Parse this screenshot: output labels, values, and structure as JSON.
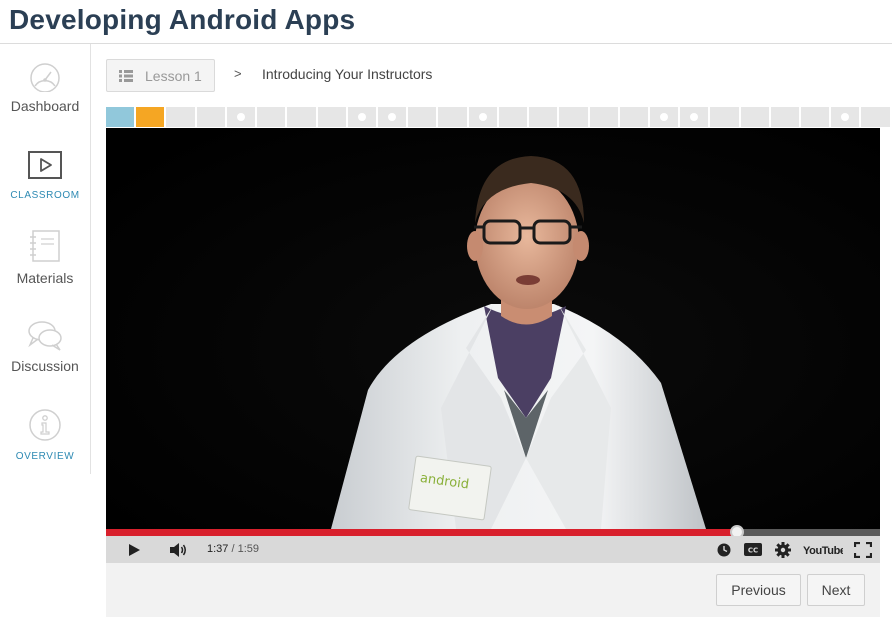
{
  "course": {
    "title": "Developing Android Apps"
  },
  "sidebar": {
    "items": [
      {
        "label": "Dashboard",
        "icon": "speedometer-icon",
        "style": "regular",
        "active": false
      },
      {
        "label": "CLASSROOM",
        "icon": "play-screen-icon",
        "style": "small",
        "active": true
      },
      {
        "label": "Materials",
        "icon": "notebook-icon",
        "style": "regular",
        "active": false
      },
      {
        "label": "Discussion",
        "icon": "chat-bubbles-icon",
        "style": "regular",
        "active": false
      },
      {
        "label": "OVERVIEW",
        "icon": "info-icon",
        "style": "small",
        "active": false
      }
    ]
  },
  "breadcrumb": {
    "lesson_label": "Lesson 1",
    "separator": ">",
    "current": "Introducing Your Instructors"
  },
  "progress_strip": {
    "segments": [
      {
        "state": "viewed"
      },
      {
        "state": "current"
      },
      {
        "state": "unvisited"
      },
      {
        "state": "unvisited"
      },
      {
        "state": "unvisited",
        "quiz": true
      },
      {
        "state": "unvisited"
      },
      {
        "state": "unvisited"
      },
      {
        "state": "unvisited"
      },
      {
        "state": "unvisited",
        "quiz": true
      },
      {
        "state": "unvisited",
        "quiz": true
      },
      {
        "state": "unvisited"
      },
      {
        "state": "unvisited"
      },
      {
        "state": "unvisited",
        "quiz": true
      },
      {
        "state": "unvisited"
      },
      {
        "state": "unvisited"
      },
      {
        "state": "unvisited"
      },
      {
        "state": "unvisited"
      },
      {
        "state": "unvisited"
      },
      {
        "state": "unvisited",
        "quiz": true
      },
      {
        "state": "unvisited",
        "quiz": true
      },
      {
        "state": "unvisited"
      },
      {
        "state": "unvisited"
      },
      {
        "state": "unvisited"
      },
      {
        "state": "unvisited"
      },
      {
        "state": "unvisited",
        "quiz": true
      },
      {
        "state": "unvisited"
      }
    ],
    "colors": {
      "viewed": "#91c8db",
      "current": "#f5a623",
      "unvisited": "#e6e6e6"
    }
  },
  "video": {
    "current_time": "1:37",
    "separator": " / ",
    "duration": "1:59",
    "progress_fraction": 0.815,
    "played_color": "#d8202c",
    "controls": {
      "play": "play-icon",
      "volume": "volume-icon",
      "watch_later": "clock-icon",
      "captions": "captions-icon",
      "captions_label": "CC",
      "settings": "gear-icon",
      "youtube": "youtube-logo-icon",
      "youtube_label": "YouTube",
      "fullscreen": "fullscreen-icon"
    },
    "badge_text": "android"
  },
  "navigation": {
    "previous_label": "Previous",
    "next_label": "Next"
  }
}
